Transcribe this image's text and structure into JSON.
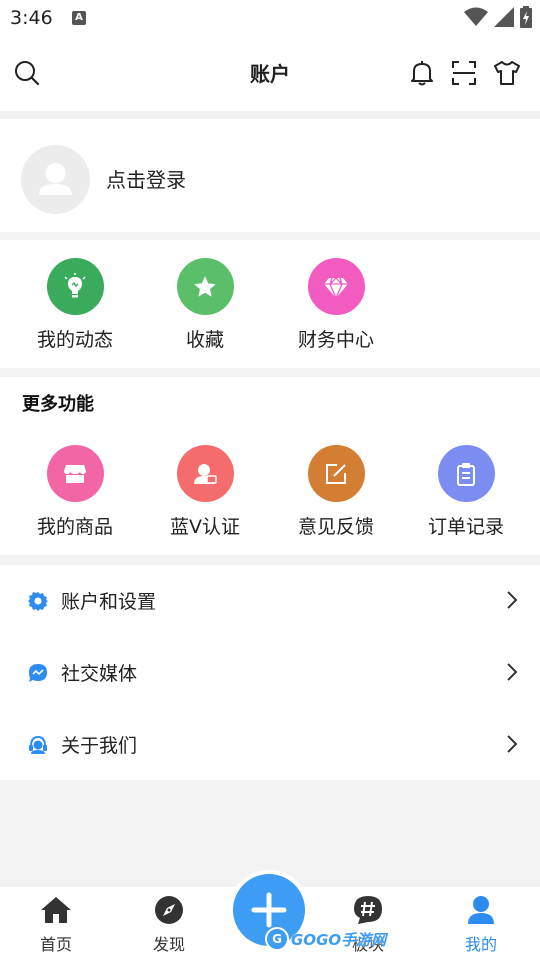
{
  "status_bar": {
    "time": "3:46",
    "notification_icon": "A"
  },
  "header": {
    "title": "账户",
    "icons": [
      "search-icon",
      "bell-icon",
      "scan-icon",
      "tshirt-icon"
    ]
  },
  "login": {
    "label": "点击登录"
  },
  "quick_actions": [
    {
      "label": "我的动态",
      "icon": "bulb-icon",
      "color": "#3aaa5c"
    },
    {
      "label": "收藏",
      "icon": "star-icon",
      "color": "#5bbf6a"
    },
    {
      "label": "财务中心",
      "icon": "diamond-icon",
      "color": "#f25cc0"
    }
  ],
  "more": {
    "title": "更多功能",
    "items": [
      {
        "label": "我的商品",
        "icon": "shop-icon",
        "color": "#f366a6"
      },
      {
        "label": "蓝V认证",
        "icon": "user-badge-icon",
        "color": "#f46c6c"
      },
      {
        "label": "意见反馈",
        "icon": "edit-icon",
        "color": "#d47e33"
      },
      {
        "label": "订单记录",
        "icon": "clipboard-icon",
        "color": "#7b8df0"
      }
    ]
  },
  "menu": [
    {
      "label": "账户和设置",
      "icon": "gear-icon"
    },
    {
      "label": "社交媒体",
      "icon": "chat-icon"
    },
    {
      "label": "关于我们",
      "icon": "headset-icon"
    }
  ],
  "tabbar": {
    "tabs": [
      {
        "label": "首页",
        "icon": "home-icon"
      },
      {
        "label": "发现",
        "icon": "compass-icon"
      },
      {
        "label": "板块",
        "icon": "hashtag-icon"
      },
      {
        "label": "我的",
        "icon": "person-icon"
      }
    ],
    "active": "我的",
    "accent": "#2d8cf0"
  },
  "watermark": {
    "text": "GOGO手游网"
  }
}
